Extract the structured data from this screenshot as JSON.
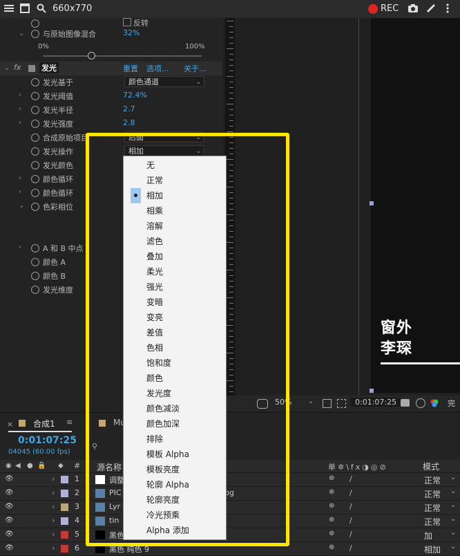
{
  "recorder": {
    "size_label": "660x770",
    "rec_label": "REC",
    "rec_color": "#e02424"
  },
  "effects": {
    "top_partial": "反转",
    "blend_label": "与原始图像混合",
    "blend_value": "32%",
    "slider_min": "0%",
    "slider_max": "100%",
    "fx_badge": "fx",
    "effect_name": "发光",
    "reset_label": "重置",
    "options_label": "选项...",
    "about_label": "关于...",
    "properties": [
      {
        "label": "发光基于",
        "type": "dropdown",
        "value": "颜色通道"
      },
      {
        "label": "发光阈值",
        "type": "value",
        "value": "72.4%"
      },
      {
        "label": "发光半径",
        "type": "value",
        "value": "2.7"
      },
      {
        "label": "发光强度",
        "type": "value",
        "value": "2.8"
      },
      {
        "label": "合成原始项目",
        "type": "dropdown",
        "value": "后面"
      },
      {
        "label": "发光操作",
        "type": "dropdown",
        "value": "相加"
      },
      {
        "label": "发光颜色",
        "type": "none",
        "value": ""
      },
      {
        "label": "颜色循环",
        "type": "none",
        "value": ""
      },
      {
        "label": "颜色循环",
        "type": "none",
        "value": ""
      },
      {
        "label": "色彩相位",
        "type": "none",
        "value": ""
      }
    ],
    "lower_properties": [
      {
        "label": "A 和 B 中点"
      },
      {
        "label": "颜色 A"
      },
      {
        "label": "颜色 B"
      },
      {
        "label": "发光维度"
      }
    ]
  },
  "menu": {
    "selected_index": 2,
    "items": [
      "无",
      "正常",
      "相加",
      "相乘",
      "溶解",
      "滤色",
      "叠加",
      "柔光",
      "强光",
      "变暗",
      "变亮",
      "差值",
      "色相",
      "饱和度",
      "颜色",
      "发光度",
      "颜色减淡",
      "颜色加深",
      "排除",
      "模板 Alpha",
      "模板亮度",
      "轮廓 Alpha",
      "轮廓亮度",
      "冷光预乘",
      "Alpha 添加"
    ]
  },
  "viewer": {
    "overlay_line1": "窗外",
    "overlay_line2": "李琛",
    "zoom": "50%",
    "timecode": "0:01:07:25",
    "quality": "完"
  },
  "timeline": {
    "comp_tab": "合成1",
    "other_tab": "Mu",
    "timecode": "0:01:07:25",
    "frames": "04045 (60.00 fps)",
    "col_number": "#",
    "col_source": "源名称",
    "col_mode": "模式",
    "layers": [
      {
        "num": "1",
        "name": "调整",
        "color": "#b1b1d6",
        "mode": "正常"
      },
      {
        "num": "2",
        "name": "PIC",
        "suffix": "jpg",
        "color": "#b1b1d6",
        "mode": "正常"
      },
      {
        "num": "3",
        "name": "Lyr",
        "color": "#b9a67d",
        "mode": "正常"
      },
      {
        "num": "4",
        "name": "tin",
        "color": "#b1b1d6",
        "mode": "正常"
      },
      {
        "num": "5",
        "name": "黑色",
        "color": "#c23a3a",
        "mode": "加"
      },
      {
        "num": "6",
        "name": "黑色 纯色 9",
        "color": "#c23a3a",
        "mode": "相加"
      }
    ]
  }
}
